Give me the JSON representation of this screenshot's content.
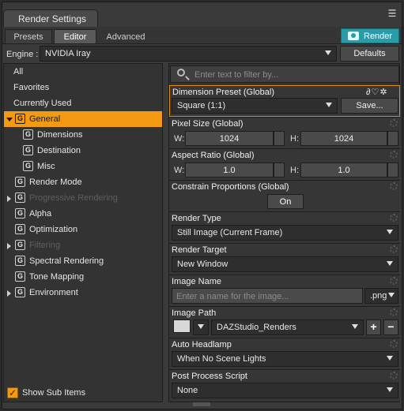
{
  "window": {
    "title": "Render Settings"
  },
  "tabs": [
    {
      "label": "Presets"
    },
    {
      "label": "Editor"
    },
    {
      "label": "Advanced"
    }
  ],
  "render_button": {
    "label": "Render"
  },
  "engine": {
    "label": "Engine :",
    "value": "NVIDIA Iray",
    "defaults_label": "Defaults"
  },
  "sidebar": {
    "items": [
      {
        "label": "All"
      },
      {
        "label": "Favorites"
      },
      {
        "label": "Currently Used"
      },
      {
        "label": "General"
      },
      {
        "label": "Dimensions"
      },
      {
        "label": "Destination"
      },
      {
        "label": "Misc"
      },
      {
        "label": "Render Mode"
      },
      {
        "label": "Progressive Rendering"
      },
      {
        "label": "Alpha"
      },
      {
        "label": "Optimization"
      },
      {
        "label": "Filtering"
      },
      {
        "label": "Spectral Rendering"
      },
      {
        "label": "Tone Mapping"
      },
      {
        "label": "Environment"
      }
    ],
    "group_icon_letter": "G",
    "show_sub_items": {
      "label": "Show Sub Items",
      "checked": true
    }
  },
  "filter": {
    "placeholder": "Enter text to filter by..."
  },
  "props": {
    "dimension_preset": {
      "label": "Dimension Preset (Global)",
      "value": "Square (1:1)",
      "save_label": "Save..."
    },
    "pixel_size": {
      "label": "Pixel Size (Global)",
      "w_label": "W:",
      "w_value": "1024",
      "h_label": "H:",
      "h_value": "1024"
    },
    "aspect_ratio": {
      "label": "Aspect Ratio (Global)",
      "w_label": "W:",
      "w_value": "1.0",
      "h_label": "H:",
      "h_value": "1.0"
    },
    "constrain": {
      "label": "Constrain Proportions (Global)",
      "value": "On"
    },
    "render_type": {
      "label": "Render Type",
      "value": "Still Image (Current Frame)"
    },
    "render_target": {
      "label": "Render Target",
      "value": "New Window"
    },
    "image_name": {
      "label": "Image Name",
      "placeholder": "Enter a name for the image...",
      "ext": ".png"
    },
    "image_path": {
      "label": "Image Path",
      "value": "DAZStudio_Renders",
      "add": "+",
      "remove": "−"
    },
    "auto_headlamp": {
      "label": "Auto Headlamp",
      "value": "When No Scene Lights"
    },
    "post_process": {
      "label": "Post Process Script",
      "value": "None"
    }
  }
}
